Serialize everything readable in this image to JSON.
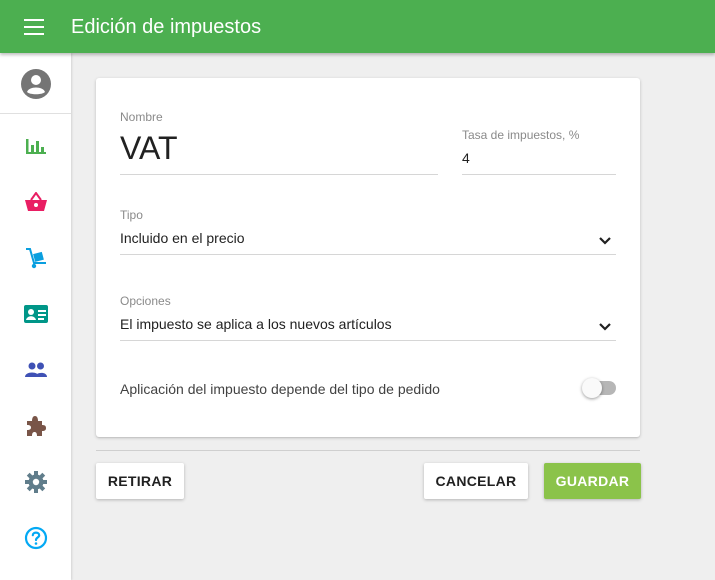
{
  "header": {
    "title": "Edición de impuestos",
    "color": "#4caf50"
  },
  "sidebar": {
    "items": [
      {
        "icon": "account-circle-icon",
        "color": "#757575"
      },
      {
        "icon": "bar-chart-icon",
        "color": "#4caf50"
      },
      {
        "icon": "basket-icon",
        "color": "#e91e63"
      },
      {
        "icon": "hand-truck-icon",
        "color": "#0a9fdf"
      },
      {
        "icon": "id-card-icon",
        "color": "#009688"
      },
      {
        "icon": "people-icon",
        "color": "#3f51b5"
      },
      {
        "icon": "puzzle-icon",
        "color": "#795548"
      },
      {
        "icon": "gear-icon",
        "color": "#607d8b"
      },
      {
        "icon": "help-icon",
        "color": "#03a9f4"
      }
    ]
  },
  "form": {
    "name_label": "Nombre",
    "name_value": "VAT",
    "rate_label": "Tasa de impuestos, %",
    "rate_value": "4",
    "type_label": "Tipo",
    "type_value": "Incluido en el precio",
    "options_label": "Opciones",
    "options_value": "El impuesto se aplica a los nuevos artículos",
    "toggle_label": "Aplicación del impuesto depende del tipo de pedido",
    "toggle_on": false
  },
  "actions": {
    "remove_label": "RETIRAR",
    "cancel_label": "CANCELAR",
    "save_label": "GUARDAR",
    "save_color": "#8bc34a"
  }
}
